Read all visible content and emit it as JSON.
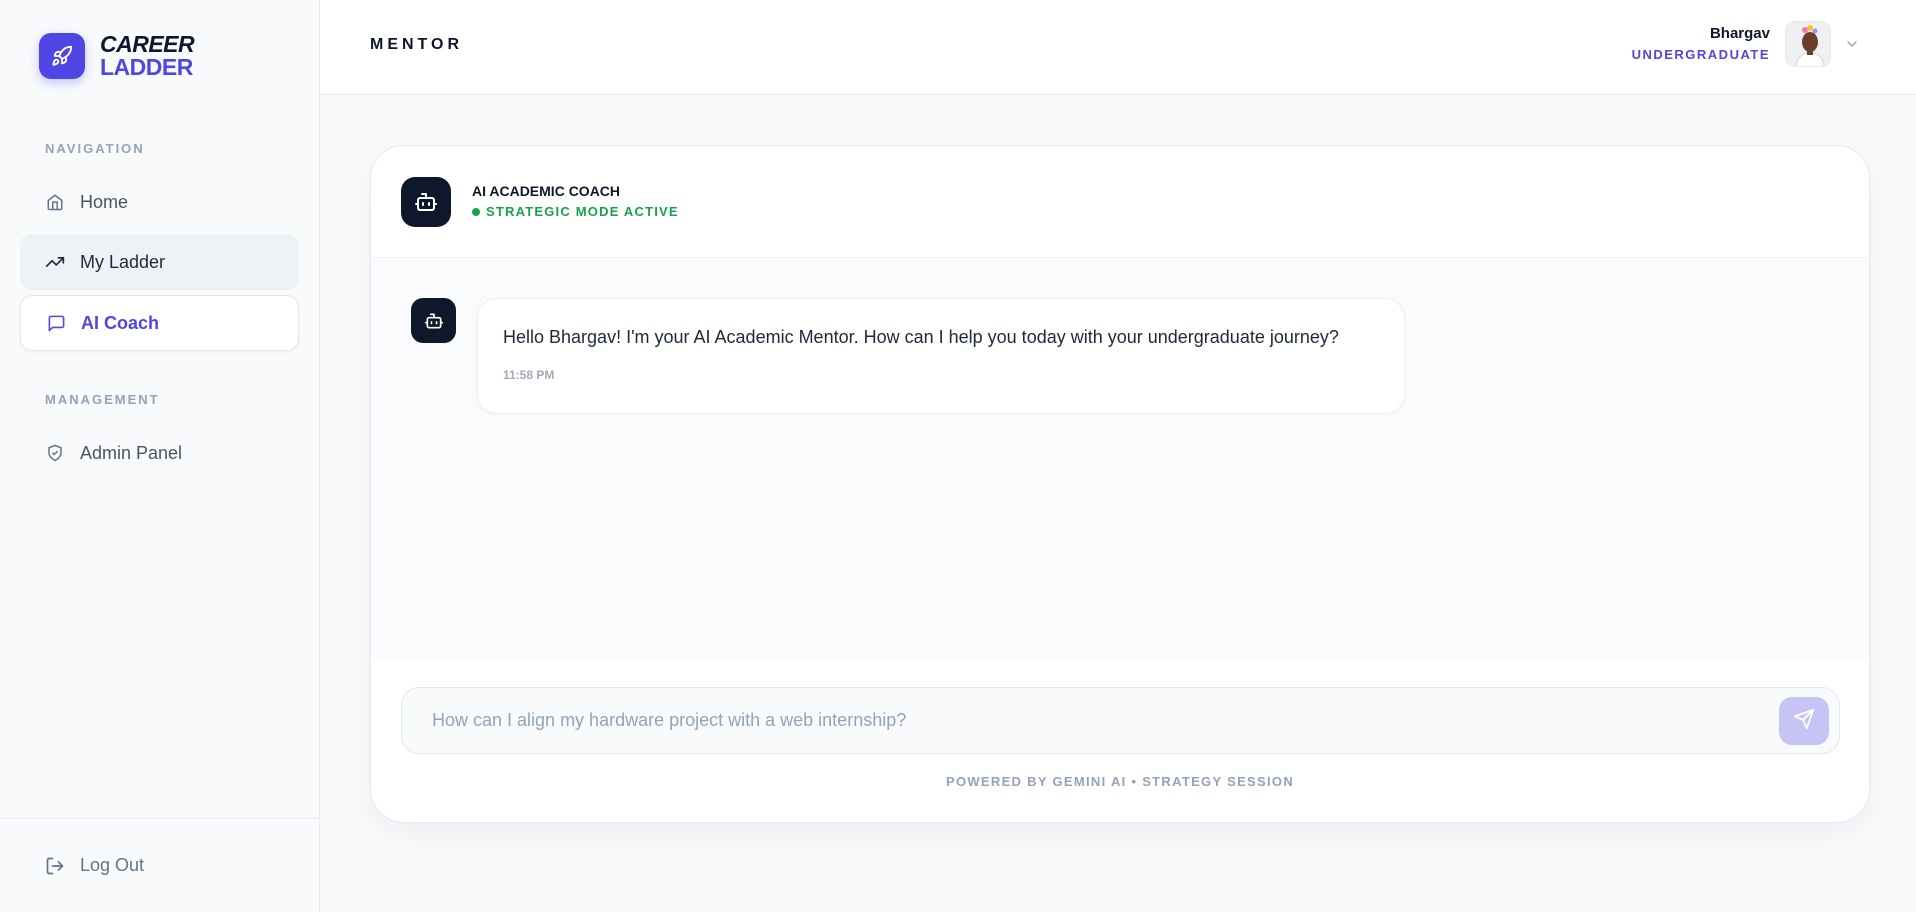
{
  "brand": {
    "line1": "CAREER",
    "line2": "LADDER",
    "accent": "#4f46e5"
  },
  "sidebar": {
    "navigation_label": "NAVIGATION",
    "items": [
      {
        "label": "Home",
        "icon": "home-icon"
      },
      {
        "label": "My Ladder",
        "icon": "trending-up-icon"
      },
      {
        "label": "AI Coach",
        "icon": "message-square-icon"
      }
    ],
    "management_label": "MANAGEMENT",
    "management_items": [
      {
        "label": "Admin Panel",
        "icon": "shield-icon"
      }
    ],
    "logout_label": "Log Out"
  },
  "header": {
    "title": "MENTOR",
    "user": {
      "name": "Bhargav",
      "role": "UNDERGRADUATE"
    }
  },
  "coach": {
    "title": "AI ACADEMIC COACH",
    "status": "STRATEGIC MODE ACTIVE",
    "status_color": "#16a34a"
  },
  "messages": [
    {
      "sender": "bot",
      "text": "Hello Bhargav! I'm your AI Academic Mentor. How can I help you today with your undergraduate journey?",
      "time": "11:58 PM"
    }
  ],
  "composer": {
    "placeholder": "How can I align my hardware project with a web internship?",
    "value": ""
  },
  "footer_note": "POWERED BY GEMINI AI • STRATEGY SESSION"
}
